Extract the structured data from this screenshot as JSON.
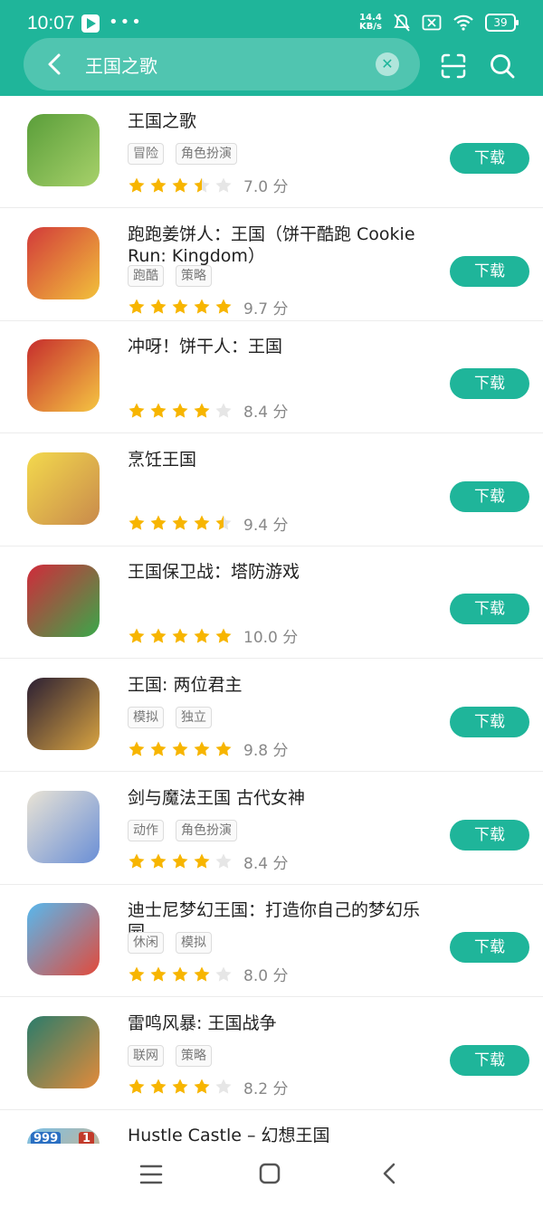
{
  "status": {
    "time": "10:07",
    "net_speed_value": "14.4",
    "net_speed_unit": "KB/s",
    "battery": "39"
  },
  "search": {
    "query": "王国之歌"
  },
  "colors": {
    "accent": "#1fb59a",
    "star": "#f7b500",
    "star_empty": "#e6e6e6"
  },
  "icons": {
    "back": "chevron-left-icon",
    "clear": "close-icon",
    "scan": "scan-icon",
    "search": "search-icon",
    "nav_menu": "menu-icon",
    "nav_home": "home-icon",
    "nav_back": "back-icon"
  },
  "apps": [
    {
      "name": "王国之歌",
      "tags": [
        "冒险",
        "角色扮演"
      ],
      "rating": 3.5,
      "score": "7.0 分",
      "button": "下载",
      "icon_colors": [
        "#5a9e3a",
        "#a7d16a"
      ]
    },
    {
      "name": "跑跑姜饼人：王国（饼干酷跑 Cookie Run: Kingdom）",
      "tags": [
        "跑酷",
        "策略"
      ],
      "rating": 5,
      "score": "9.7 分",
      "button": "下载",
      "icon_colors": [
        "#d23a3a",
        "#f2c13b"
      ]
    },
    {
      "name": "冲呀！饼干人：王国",
      "tags": [],
      "rating": 4,
      "score": "8.4 分",
      "button": "下载",
      "icon_colors": [
        "#c62d2d",
        "#f5c542"
      ]
    },
    {
      "name": "烹饪王国",
      "tags": [],
      "rating": 4.5,
      "score": "9.4 分",
      "button": "下载",
      "icon_colors": [
        "#f3d94d",
        "#c98a4b"
      ]
    },
    {
      "name": "王国保卫战：塔防游戏",
      "tags": [],
      "rating": 5,
      "score": "10.0 分",
      "button": "下载",
      "icon_colors": [
        "#d12a3b",
        "#3aa84a"
      ]
    },
    {
      "name": "王国: 两位君主",
      "tags": [
        "模拟",
        "独立"
      ],
      "rating": 5,
      "score": "9.8 分",
      "button": "下载",
      "icon_colors": [
        "#2b1f33",
        "#d9a441"
      ]
    },
    {
      "name": "剑与魔法王国 古代女神",
      "tags": [
        "动作",
        "角色扮演"
      ],
      "rating": 4,
      "score": "8.4 分",
      "button": "下载",
      "icon_colors": [
        "#e9e3d5",
        "#6a8fd6"
      ]
    },
    {
      "name": "迪士尼梦幻王国：打造你自己的梦幻乐园",
      "tags": [
        "休闲",
        "模拟"
      ],
      "rating": 4,
      "score": "8.0 分",
      "button": "下载",
      "icon_colors": [
        "#57b8ee",
        "#e24a3b"
      ]
    },
    {
      "name": "雷鸣风暴: 王国战争",
      "tags": [
        "联网",
        "策略"
      ],
      "rating": 4,
      "score": "8.2 分",
      "button": "下载",
      "icon_colors": [
        "#2a7c6b",
        "#e38b3a"
      ]
    },
    {
      "name": "Hustle Castle – 幻想王国",
      "tags": [],
      "rating": 0,
      "score": "",
      "button": "",
      "icon_colors": [
        "#79c0e8",
        "#e7b070"
      ],
      "badges": [
        "999",
        "1"
      ]
    }
  ]
}
